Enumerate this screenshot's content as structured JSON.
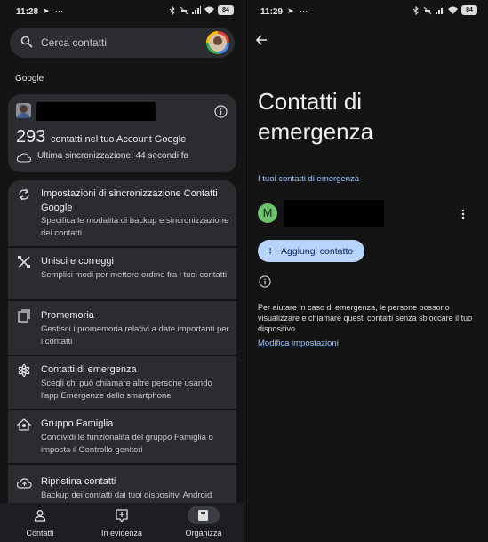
{
  "left_screen": {
    "status_bar": {
      "time": "11:28",
      "battery": "84"
    },
    "search": {
      "placeholder": "Cerca contatti"
    },
    "section_label": "Google",
    "account_card": {
      "count": "293",
      "count_text": "contatti nel tuo Account Google",
      "sync_text": "Ultima sincronizzazione: 44 secondi fa"
    },
    "menu": [
      {
        "icon": "sync-icon",
        "title": "Impostazioni di sincronizzazione Contatti Google",
        "desc": "Specifica le modalità di backup e sincronizzazione dei contatti"
      },
      {
        "icon": "merge-tools-icon",
        "title": "Unisci e correggi",
        "desc": "Semplici modi per mettere ordine fra i tuoi contatti"
      },
      {
        "icon": "reminder-icon",
        "title": "Promemoria",
        "desc": "Gestisci i promemoria relativi a date importanti per i contatti"
      },
      {
        "icon": "emergency-icon",
        "title": "Contatti di emergenza",
        "desc": "Scegli chi può chiamare altre persone usando l'app Emergenze dello smartphone"
      },
      {
        "icon": "family-home-icon",
        "title": "Gruppo Famiglia",
        "desc": "Condividi le funzionalità del gruppo Famiglia o imposta il Controllo genitori"
      },
      {
        "icon": "cloud-restore-icon",
        "title": "Ripristina contatti",
        "desc": "Backup dei contatti dai tuoi dispositivi Android"
      }
    ],
    "bottom_nav": [
      {
        "icon": "person-icon",
        "label": "Contatti"
      },
      {
        "icon": "highlight-icon",
        "label": "In evidenza"
      },
      {
        "icon": "organize-icon",
        "label": "Organizza",
        "active": true
      }
    ]
  },
  "right_screen": {
    "status_bar": {
      "time": "11:29",
      "battery": "84"
    },
    "title": "Contatti di emergenza",
    "subsection": "I tuoi contatti di emergenza",
    "contact": {
      "initial": "M"
    },
    "add_button": "Aggiungi contatto",
    "help_text": "Per aiutare in caso di emergenza, le persone possono visualizzare e chiamare questi contatti senza sbloccare il tuo dispositivo.",
    "settings_link": "Modifica impostazioni"
  },
  "colors": {
    "background": "#141414",
    "card": "#2b2c30",
    "accent_link": "#9ec5ff",
    "button_fill": "#b7d3ff",
    "avatar_green": "#6ec06e"
  }
}
